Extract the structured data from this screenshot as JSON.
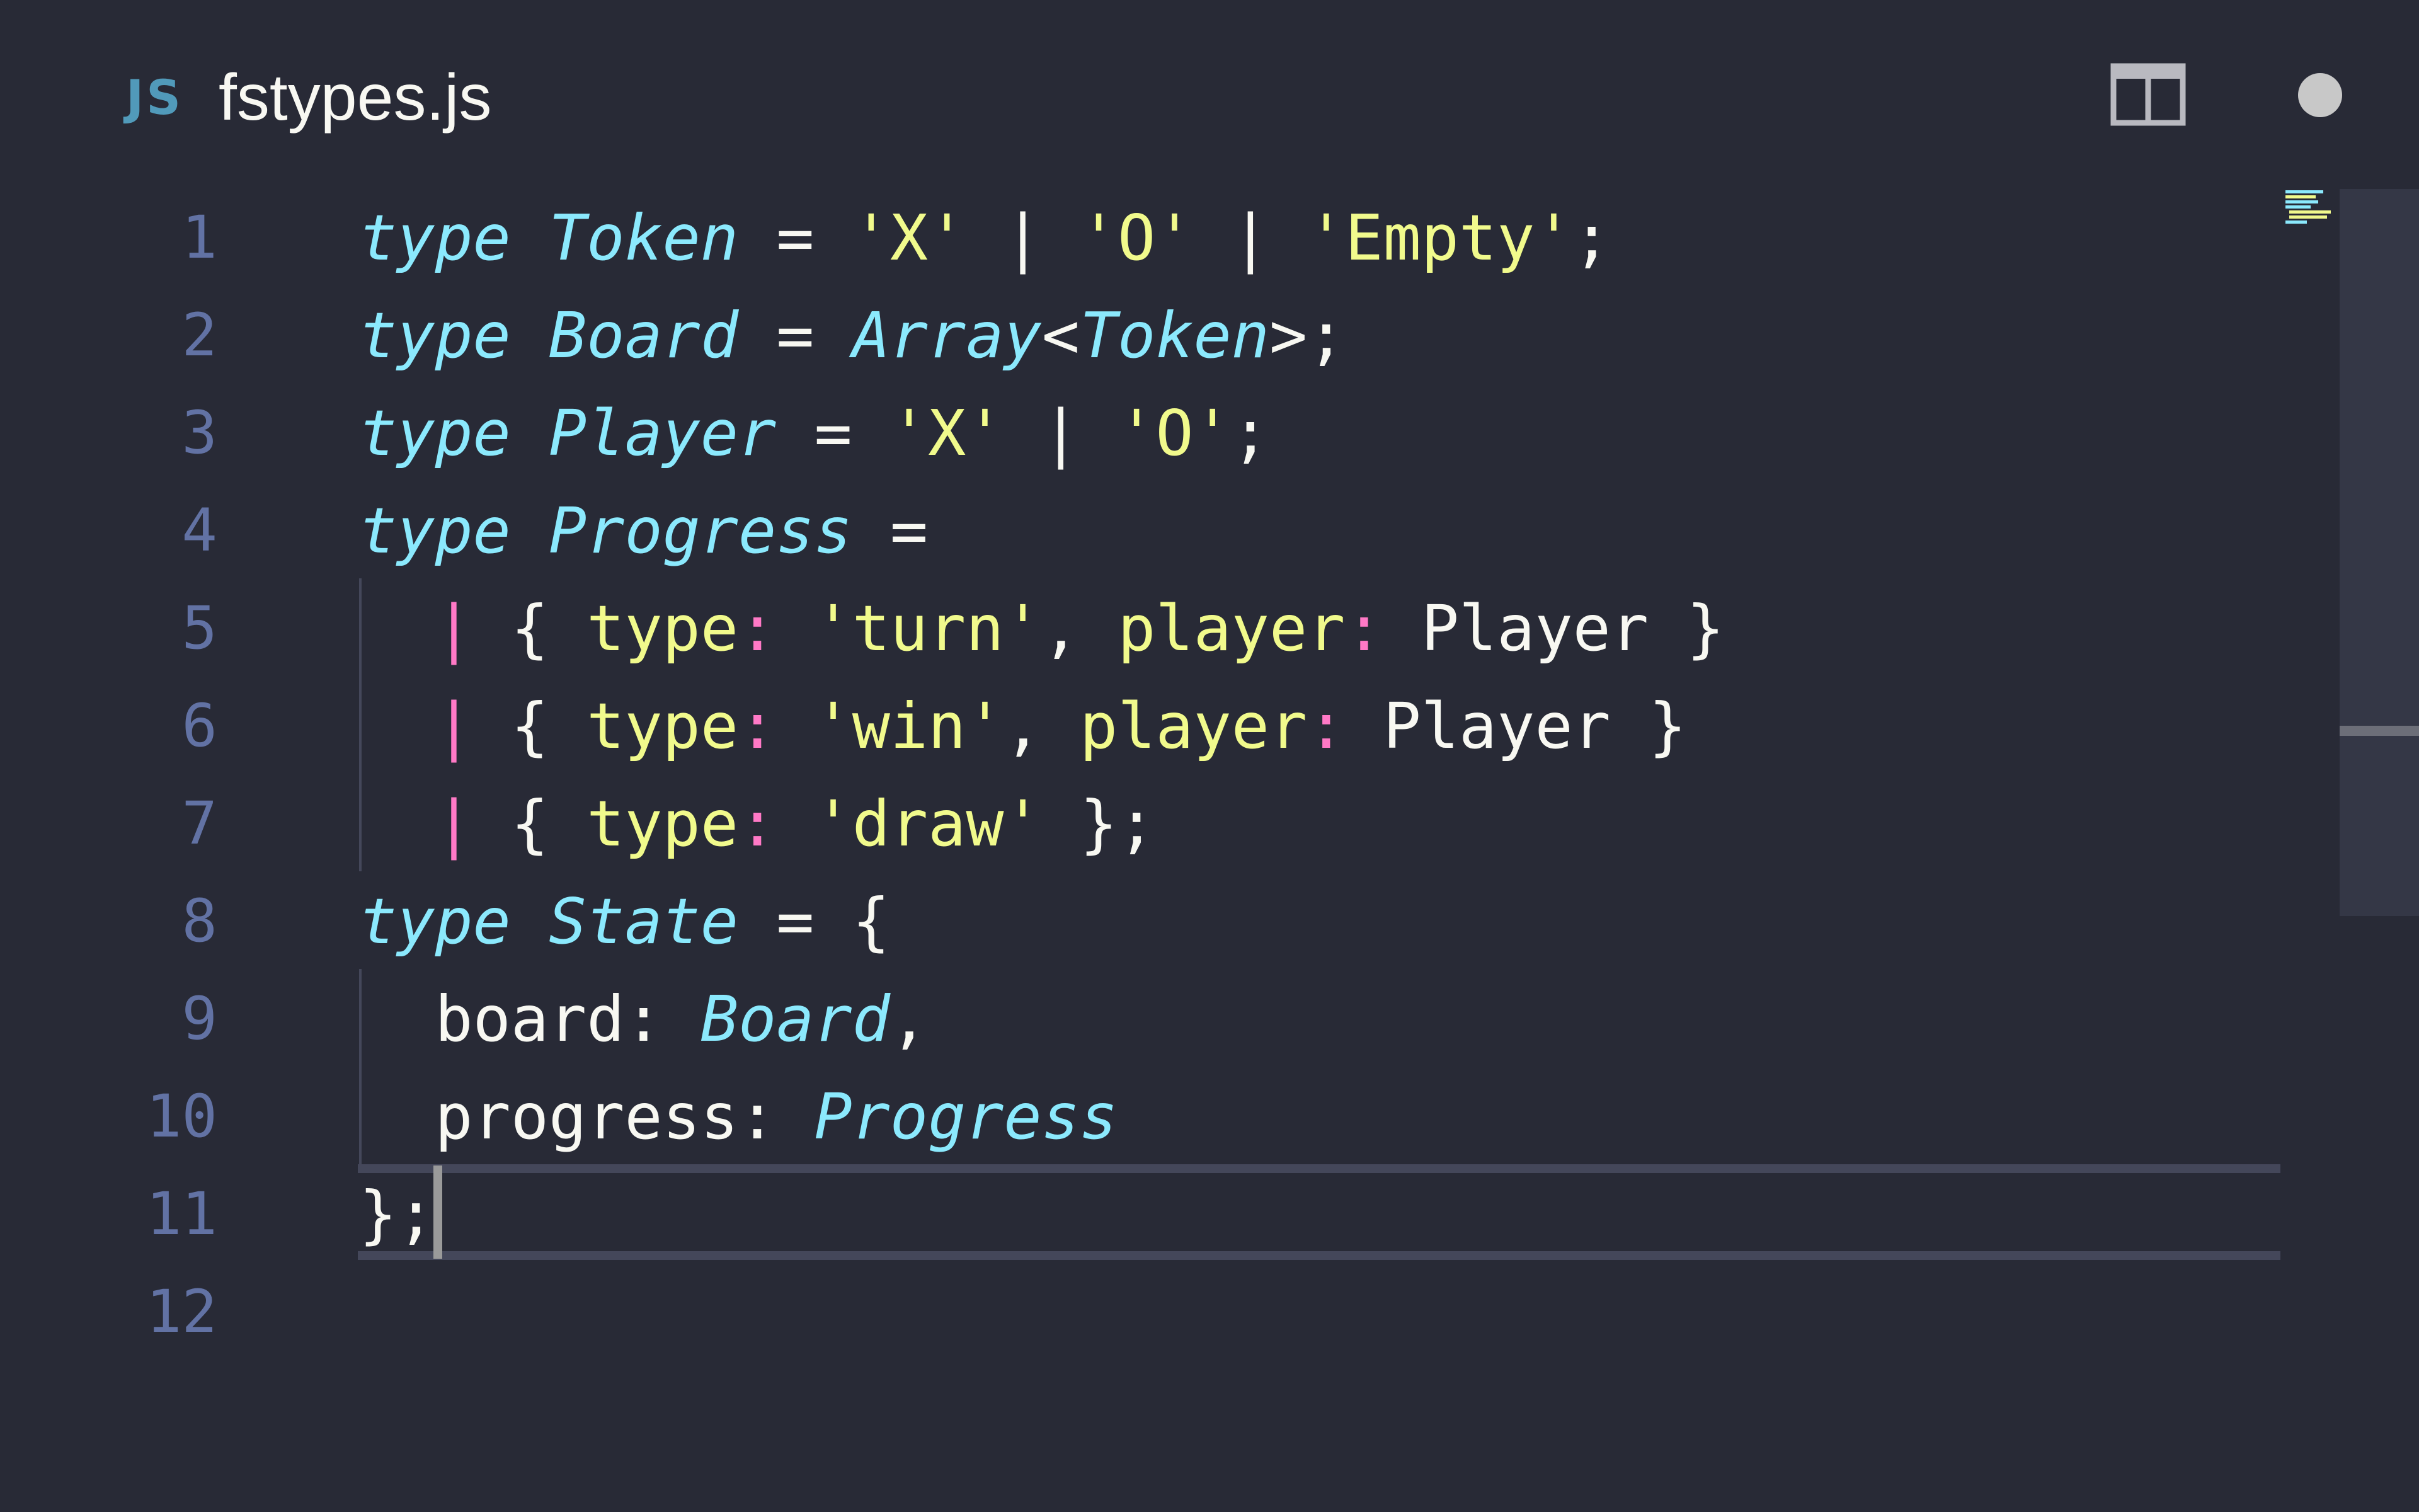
{
  "tab": {
    "file_type_icon_text": "JS",
    "file_name": "fstypes.js",
    "unsaved": true
  },
  "colors": {
    "background": "#282a36",
    "keyword": "#8be9fd",
    "string": "#f1fa8c",
    "operator": "#ff79c6",
    "line_number": "#6272a4",
    "js_icon": "#519aba"
  },
  "editor": {
    "line_numbers": [
      "1",
      "2",
      "3",
      "4",
      "5",
      "6",
      "7",
      "8",
      "9",
      "10",
      "11",
      "12"
    ],
    "cursor_line": 11,
    "lines": [
      [
        {
          "t": "type",
          "c": "kw"
        },
        {
          "t": " ",
          "c": "plain"
        },
        {
          "t": "Token",
          "c": "ty"
        },
        {
          "t": " = ",
          "c": "plain"
        },
        {
          "t": "'X'",
          "c": "str"
        },
        {
          "t": " | ",
          "c": "plain"
        },
        {
          "t": "'O'",
          "c": "str"
        },
        {
          "t": " | ",
          "c": "plain"
        },
        {
          "t": "'Empty'",
          "c": "str"
        },
        {
          "t": ";",
          "c": "plain"
        }
      ],
      [
        {
          "t": "type",
          "c": "kw"
        },
        {
          "t": " ",
          "c": "plain"
        },
        {
          "t": "Board",
          "c": "ty"
        },
        {
          "t": " = ",
          "c": "plain"
        },
        {
          "t": "Array",
          "c": "ty"
        },
        {
          "t": "<",
          "c": "plain"
        },
        {
          "t": "Token",
          "c": "ty"
        },
        {
          "t": ">;",
          "c": "plain"
        }
      ],
      [
        {
          "t": "type",
          "c": "kw"
        },
        {
          "t": " ",
          "c": "plain"
        },
        {
          "t": "Player",
          "c": "ty"
        },
        {
          "t": " = ",
          "c": "plain"
        },
        {
          "t": "'X'",
          "c": "str"
        },
        {
          "t": " | ",
          "c": "plain"
        },
        {
          "t": "'O'",
          "c": "str"
        },
        {
          "t": ";",
          "c": "plain"
        }
      ],
      [
        {
          "t": "type",
          "c": "kw"
        },
        {
          "t": " ",
          "c": "plain"
        },
        {
          "t": "Progress",
          "c": "ty"
        },
        {
          "t": " =",
          "c": "plain"
        }
      ],
      [
        {
          "t": "  ",
          "c": "plain"
        },
        {
          "t": "|",
          "c": "pink"
        },
        {
          "t": " { ",
          "c": "plain"
        },
        {
          "t": "type",
          "c": "prop"
        },
        {
          "t": ":",
          "c": "pink"
        },
        {
          "t": " ",
          "c": "plain"
        },
        {
          "t": "'turn'",
          "c": "str"
        },
        {
          "t": ", ",
          "c": "plain"
        },
        {
          "t": "player",
          "c": "prop"
        },
        {
          "t": ":",
          "c": "pink"
        },
        {
          "t": " Player }",
          "c": "plain"
        }
      ],
      [
        {
          "t": "  ",
          "c": "plain"
        },
        {
          "t": "|",
          "c": "pink"
        },
        {
          "t": " { ",
          "c": "plain"
        },
        {
          "t": "type",
          "c": "prop"
        },
        {
          "t": ":",
          "c": "pink"
        },
        {
          "t": " ",
          "c": "plain"
        },
        {
          "t": "'win'",
          "c": "str"
        },
        {
          "t": ", ",
          "c": "plain"
        },
        {
          "t": "player",
          "c": "prop"
        },
        {
          "t": ":",
          "c": "pink"
        },
        {
          "t": " Player }",
          "c": "plain"
        }
      ],
      [
        {
          "t": "  ",
          "c": "plain"
        },
        {
          "t": "|",
          "c": "pink"
        },
        {
          "t": " { ",
          "c": "plain"
        },
        {
          "t": "type",
          "c": "prop"
        },
        {
          "t": ":",
          "c": "pink"
        },
        {
          "t": " ",
          "c": "plain"
        },
        {
          "t": "'draw'",
          "c": "str"
        },
        {
          "t": " };",
          "c": "plain"
        }
      ],
      [
        {
          "t": "type",
          "c": "kw"
        },
        {
          "t": " ",
          "c": "plain"
        },
        {
          "t": "State",
          "c": "ty"
        },
        {
          "t": " = {",
          "c": "plain"
        }
      ],
      [
        {
          "t": "  board: ",
          "c": "plain"
        },
        {
          "t": "Board",
          "c": "ty"
        },
        {
          "t": ",",
          "c": "plain"
        }
      ],
      [
        {
          "t": "  progress: ",
          "c": "plain"
        },
        {
          "t": "Progress",
          "c": "ty"
        }
      ],
      [
        {
          "t": "};",
          "c": "plain"
        }
      ],
      []
    ]
  }
}
